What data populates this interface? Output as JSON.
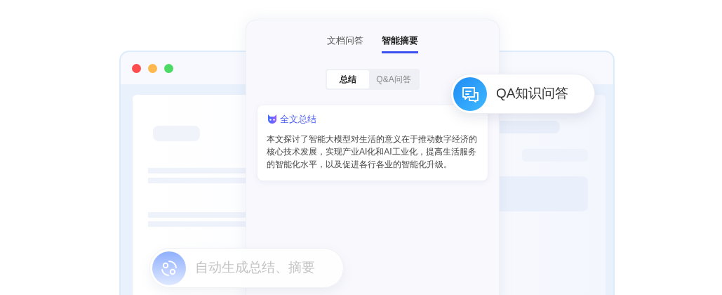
{
  "tabs": [
    {
      "label": "文档问答",
      "selected": false
    },
    {
      "label": "智能摘要",
      "selected": true
    }
  ],
  "segments": [
    {
      "label": "总结",
      "selected": true
    },
    {
      "label": "Q&A问答",
      "selected": false
    }
  ],
  "summary_card": {
    "title": "全文总结",
    "body": "本文探讨了智能大模型对生活的意义在于推动数字经济的核心技术发展，实现产业AI化和AI工业化，提高生活服务的智能化水平，以及促进各行各业的智能化升级。"
  },
  "qa_badge": {
    "label": "QA知识问答"
  },
  "auto_badge": {
    "label": "自动生成总结、摘要"
  }
}
